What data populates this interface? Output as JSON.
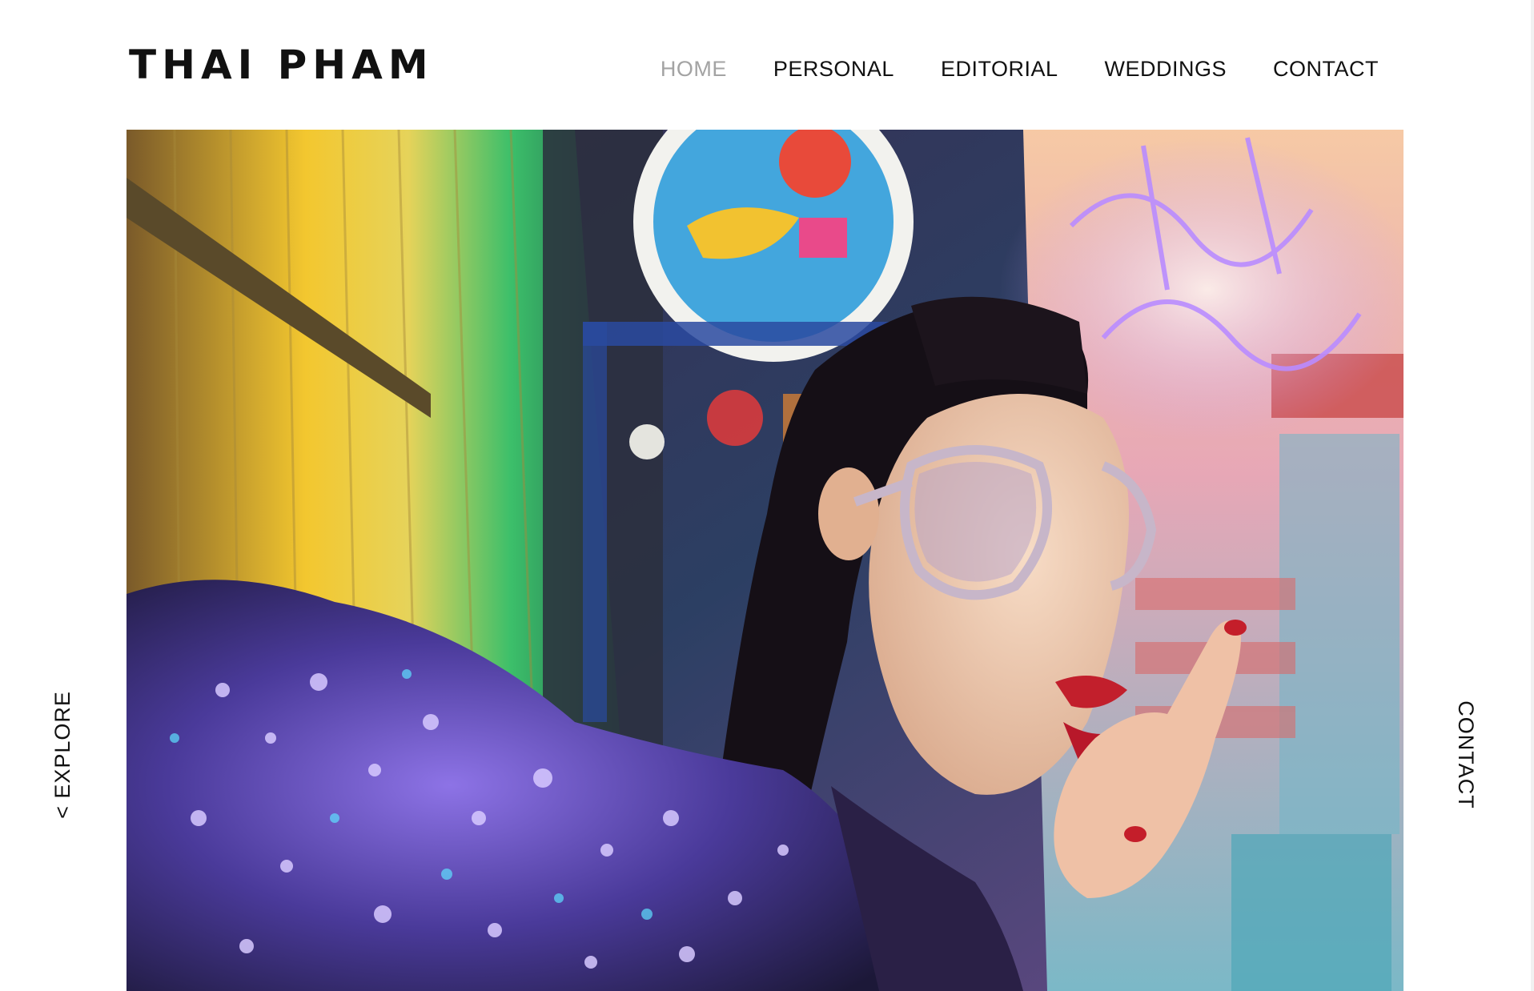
{
  "site": {
    "logo_text": "THAI PHAM"
  },
  "nav": {
    "items": [
      {
        "label": "HOME",
        "active": true
      },
      {
        "label": "PERSONAL",
        "active": false
      },
      {
        "label": "EDITORIAL",
        "active": false
      },
      {
        "label": "WEDDINGS",
        "active": false
      },
      {
        "label": "CONTACT",
        "active": false
      }
    ],
    "active_color": "#a3a3a3",
    "text_color": "#111111"
  },
  "side": {
    "left_label": "< EXPLORE",
    "right_label": "CONTACT"
  },
  "hero": {
    "image_name": "hero-photo",
    "palette": [
      "#f2c230",
      "#2b2250",
      "#7a4fd6",
      "#e94a8a",
      "#3fc7c0",
      "#c21f2c"
    ]
  }
}
